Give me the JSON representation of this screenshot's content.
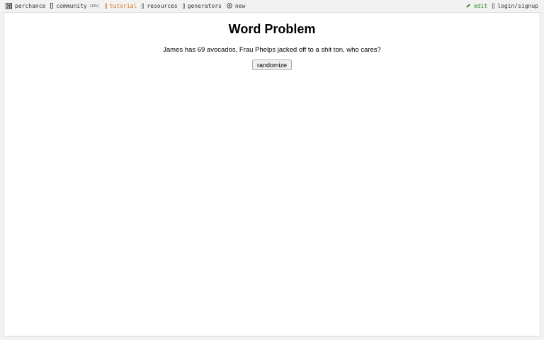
{
  "topbar": {
    "brand": {
      "label": "perchance",
      "icon": "dice-icon"
    },
    "community": {
      "label": "community",
      "count": "(10h)",
      "icon": "chat-icon"
    },
    "tutorial": {
      "label": "tutorial",
      "icon": "book-icon",
      "color": "#d9731a"
    },
    "resources": {
      "label": "resources",
      "icon": "resources-icon"
    },
    "generators": {
      "label": "generators",
      "icon": "generators-icon"
    },
    "new": {
      "label": "new",
      "icon": "plus-circle-icon"
    },
    "edit": {
      "label": "edit",
      "icon": "pencil-icon",
      "color": "#2e8b2e"
    },
    "login": {
      "label": "login/signup",
      "icon": "user-icon"
    }
  },
  "main": {
    "title": "Word Problem",
    "output": "James has 69 avocados, Frau Phelps jacked off to a shit ton, who cares?",
    "randomize_label": "randomize"
  }
}
